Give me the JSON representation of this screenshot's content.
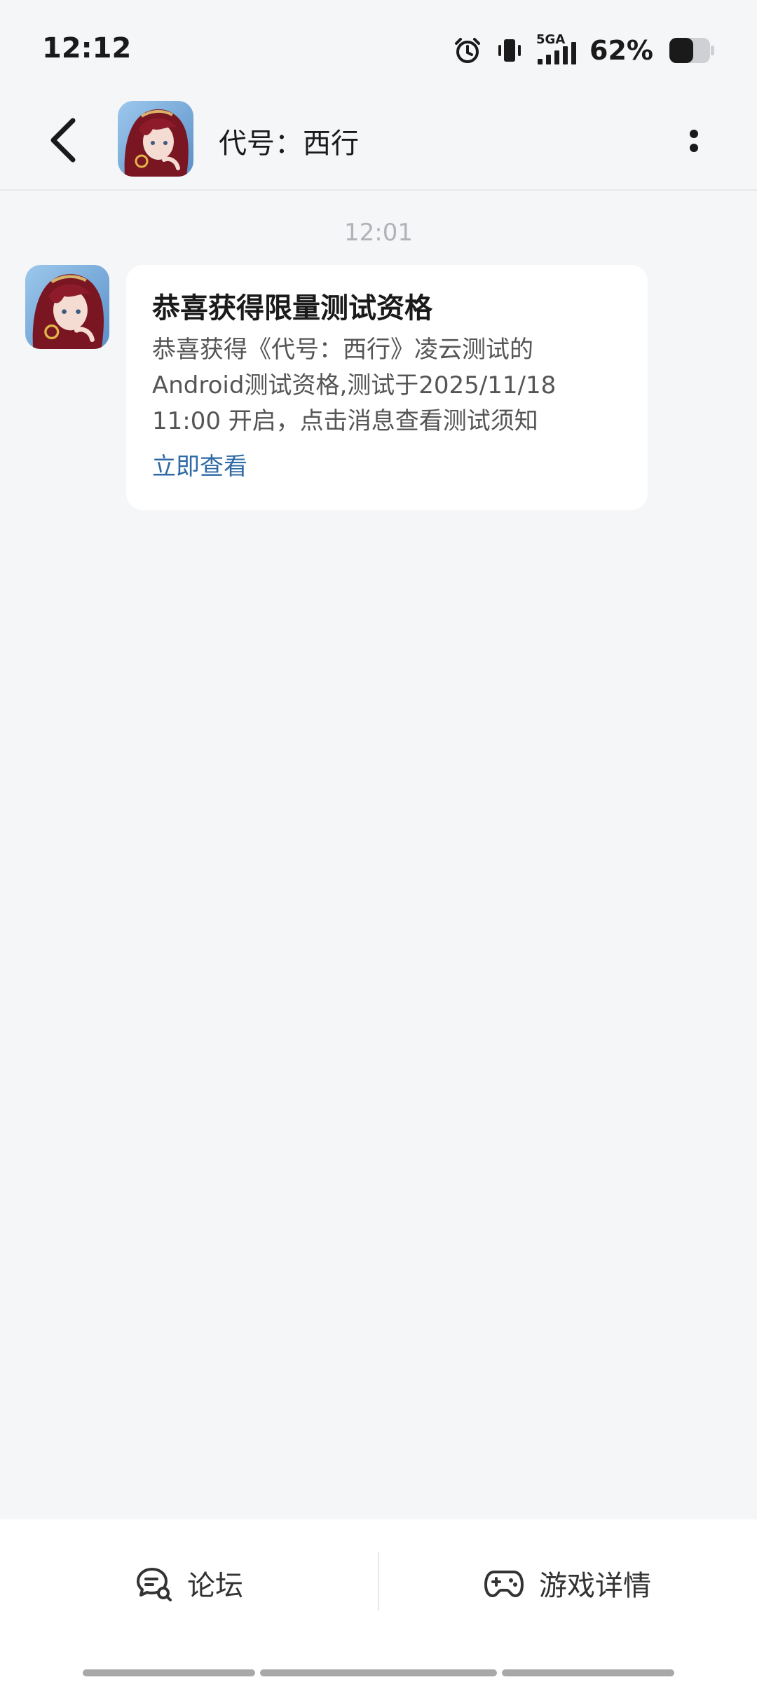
{
  "status_bar": {
    "time": "12:12",
    "network": "5GA",
    "battery": "62%",
    "icons": [
      "alarm-icon",
      "vibrate-icon",
      "signal-icon",
      "battery-icon"
    ]
  },
  "header": {
    "title": "代号：西行",
    "back_icon": "chevron-left-icon",
    "more_icon": "more-vertical-icon"
  },
  "chat": {
    "timestamp": "12:01",
    "message": {
      "title": "恭喜获得限量测试资格",
      "body_lines": [
        "恭喜获得《代号：西行》凌云测试的",
        "Android测试资格,测试于2025/11/18",
        "11:00 开启，点击消息查看测试须知"
      ],
      "link": "立即查看"
    }
  },
  "bottom_bar": {
    "forum_label": "论坛",
    "game_detail_label": "游戏详情"
  },
  "colors": {
    "background": "#f5f6f8",
    "card": "#ffffff",
    "link": "#2f6aa6",
    "timestamp": "#b0b3b8"
  }
}
